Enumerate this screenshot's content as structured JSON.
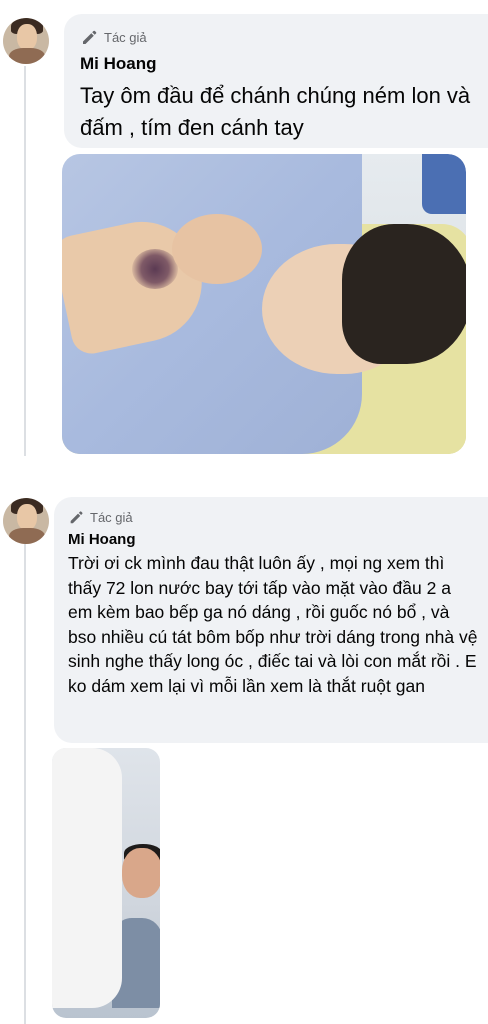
{
  "comments": [
    {
      "badge_label": "Tác giả",
      "author": "Mi Hoang",
      "text": "Tay ôm đầu để chánh chúng ném lon và đấm , tím đen cánh tay"
    },
    {
      "badge_label": "Tác giả",
      "author": "Mi Hoang",
      "text": "Trời ơi ck mình đau thật luôn ấy , mọi ng xem thì thấy 72 lon nước bay tới tấp vào mặt vào đầu 2 a em kèm bao bếp ga nó dáng , rồi guốc nó bổ , và bso nhiều cú tát bôm bốp như trời dáng trong nhà vệ sinh nghe thấy long óc , điếc tai và lòi con mắt rồi . E ko dám xem lại vì mỗi lần xem là thắt ruột gan"
    }
  ],
  "colors": {
    "bubble": "#f0f2f5",
    "badge_text": "#65676b",
    "text": "#050505"
  },
  "icons": {
    "badge": "pencil-icon"
  }
}
